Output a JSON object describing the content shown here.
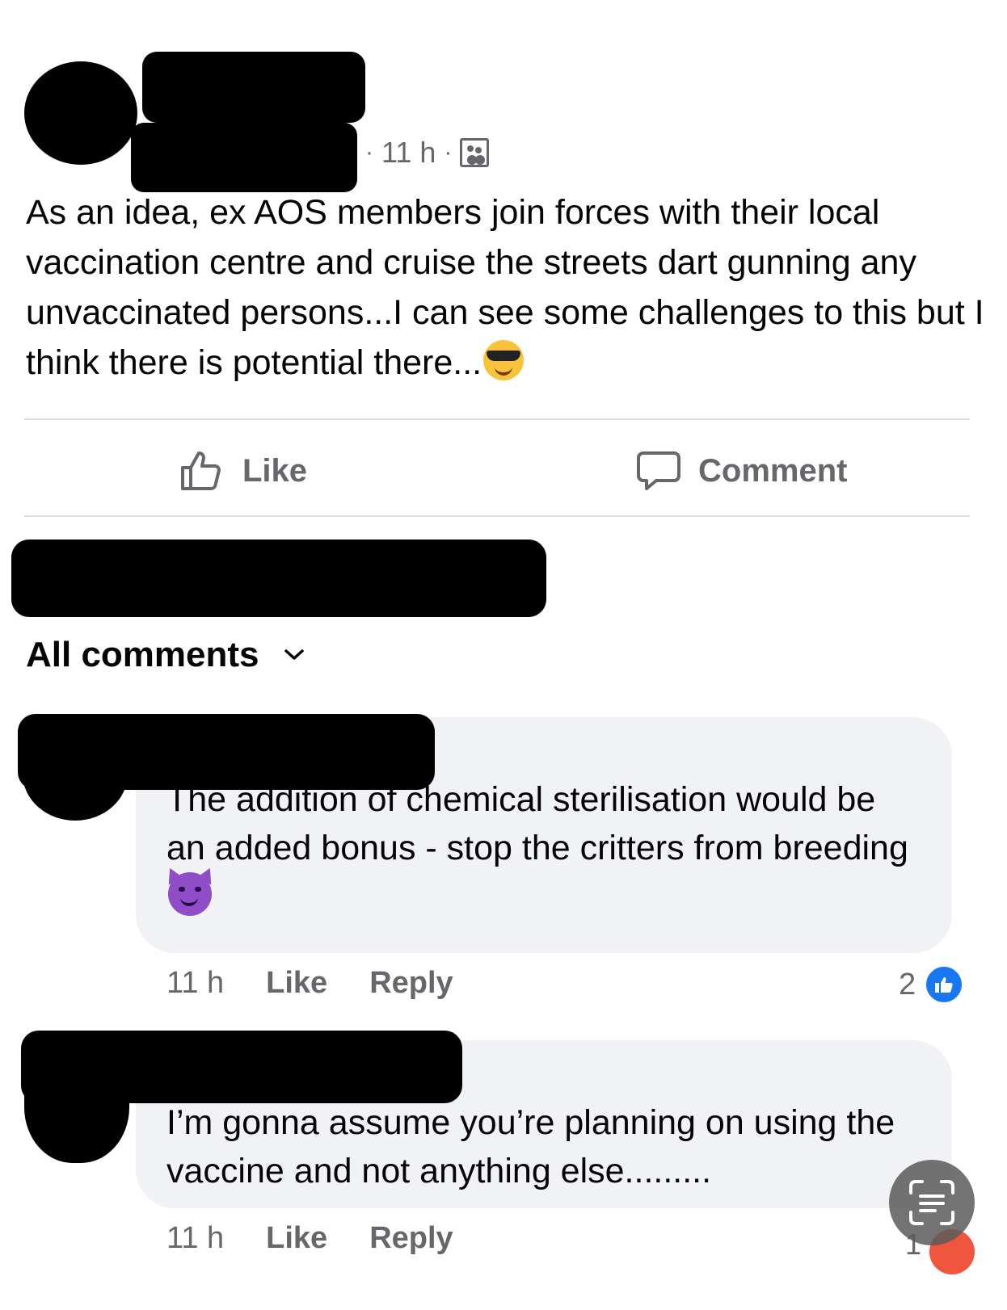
{
  "post": {
    "time": "11 h",
    "separator": "·",
    "visibility_icon": "group-members-icon",
    "text": "As an idea, ex AOS members join forces with their local vaccination centre and cruise the streets dart gunning any unvaccinated persons...I can see some challenges to this but I think there is potential there...",
    "emoji": "smiling-face-with-sunglasses"
  },
  "actions": {
    "like_label": "Like",
    "comment_label": "Comment"
  },
  "comments_filter": {
    "label": "All comments"
  },
  "comments": [
    {
      "text": "The addition of chemical sterilisation would be an added bonus - stop the critters from breeding",
      "emoji": "smiling-face-with-horns",
      "time": "11 h",
      "like_label": "Like",
      "reply_label": "Reply",
      "reaction_count": "2"
    },
    {
      "text": "I’m gonna assume you’re planning on using the vaccine and not anything else.........",
      "time": "11 h",
      "like_label": "Like",
      "reply_label": "Reply",
      "reaction_count": "1"
    }
  ],
  "colors": {
    "secondary_text": "#65676b",
    "bubble": "#f0f2f5",
    "like_blue": "#1877f2",
    "divider": "#dadde1"
  }
}
